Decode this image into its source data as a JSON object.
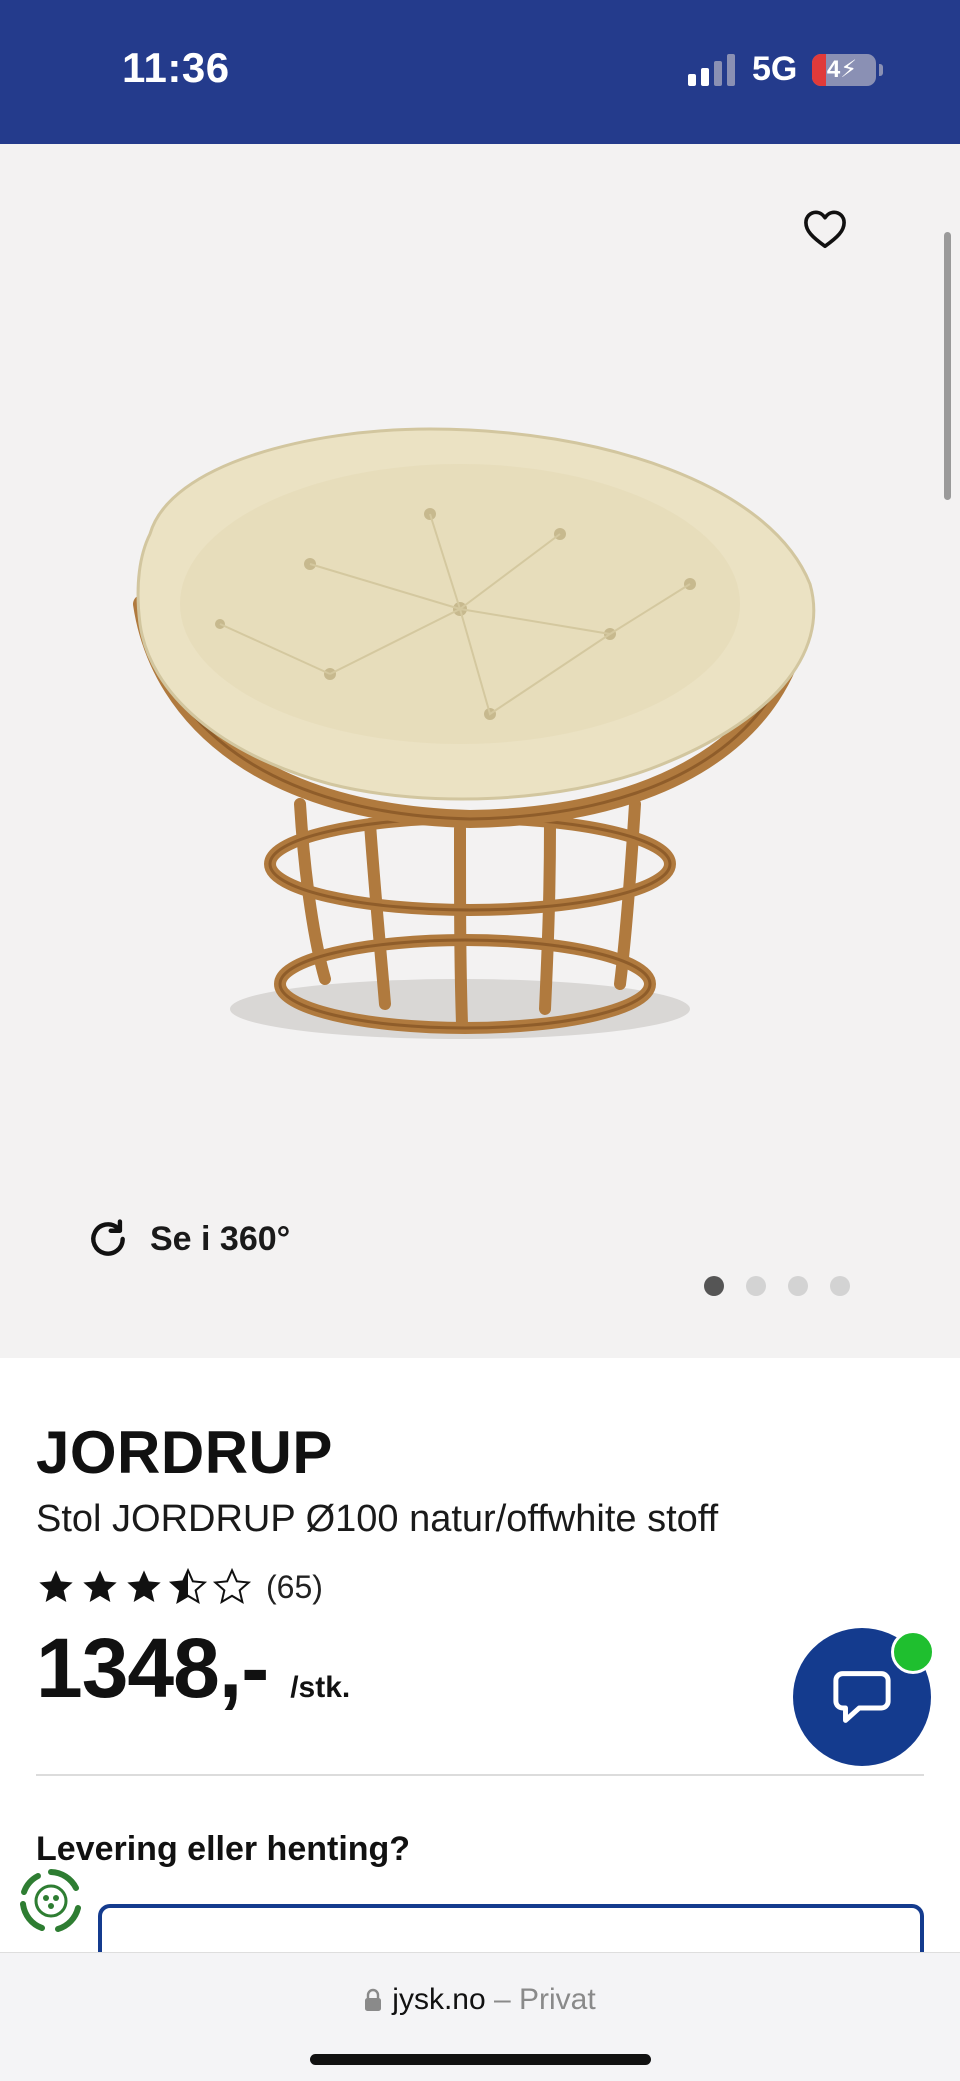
{
  "status_bar": {
    "time": "11:36",
    "network": "5G",
    "battery": "4",
    "background": "#243b8c"
  },
  "gallery": {
    "view_360_label": "Se i 360°",
    "image_count": 4,
    "active_image": 1,
    "favorite_icon": "heart-outline-icon"
  },
  "product": {
    "brand": "JORDRUP",
    "name": "Stol JORDRUP Ø100 natur/offwhite stoff",
    "rating": 3.5,
    "rating_max": 5,
    "review_count": "(65)",
    "price": "1348,-",
    "unit": "/stk."
  },
  "delivery": {
    "heading": "Levering eller henting?"
  },
  "browser": {
    "domain": "jysk.no",
    "separator": " – ",
    "mode": "Privat"
  },
  "colors": {
    "brand_blue": "#143b8e",
    "chat_online": "#1fbf2f"
  }
}
